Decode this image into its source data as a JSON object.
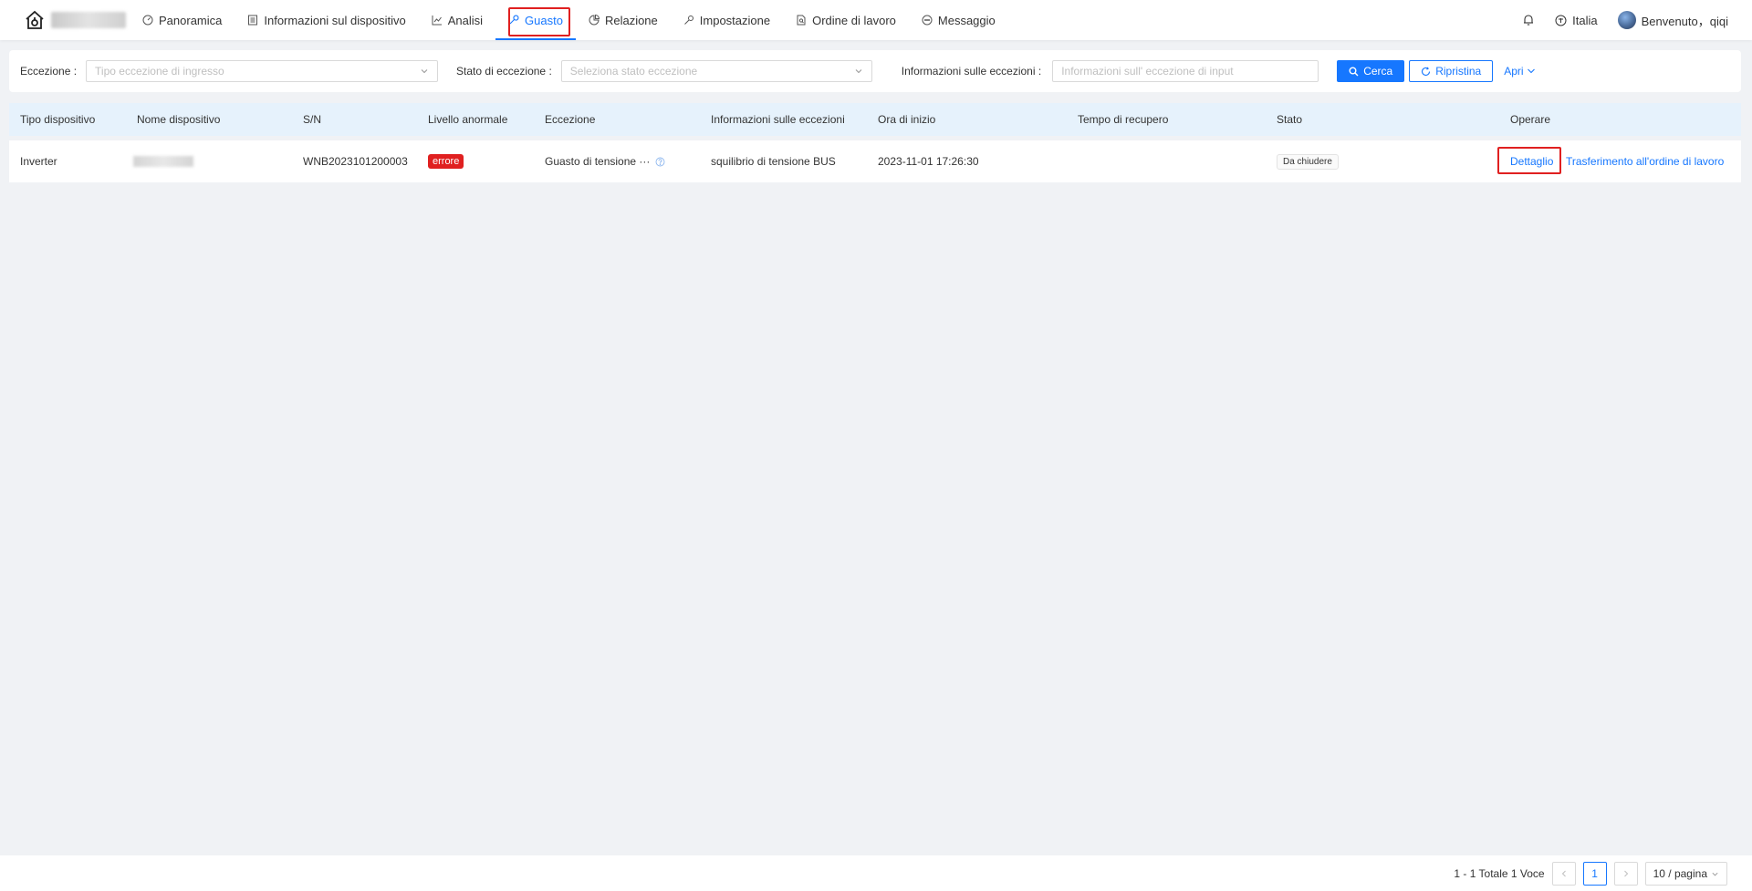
{
  "nav": {
    "items": [
      {
        "label": "Panoramica",
        "icon": "dashboard-icon"
      },
      {
        "label": "Informazioni sul dispositivo",
        "icon": "list-icon"
      },
      {
        "label": "Analisi",
        "icon": "line-chart-icon"
      },
      {
        "label": "Guasto",
        "icon": "wrench-icon",
        "active": true
      },
      {
        "label": "Relazione",
        "icon": "pie-chart-icon"
      },
      {
        "label": "Impostazione",
        "icon": "tool-icon"
      },
      {
        "label": "Ordine di lavoro",
        "icon": "file-search-icon"
      },
      {
        "label": "Messaggio",
        "icon": "message-icon"
      }
    ],
    "language": "Italia",
    "welcome": "Benvenuto，qiqi"
  },
  "filters": {
    "exception_label": "Eccezione :",
    "exception_placeholder": "Tipo eccezione di ingresso",
    "status_label": "Stato di eccezione :",
    "status_placeholder": "Seleziona stato eccezione",
    "info_label": "Informazioni sulle eccezioni :",
    "info_placeholder": "Informazioni sull' eccezione di input",
    "search_button": "Cerca",
    "reset_button": "Ripristina",
    "expand_link": "Apri"
  },
  "table": {
    "headers": [
      "Tipo dispositivo",
      "Nome dispositivo",
      "S/N",
      "Livello anormale",
      "Eccezione",
      "Informazioni sulle eccezioni",
      "Ora di inizio",
      "Tempo di recupero",
      "Stato",
      "Operare"
    ],
    "rows": [
      {
        "type": "Inverter",
        "sn": "WNB2023101200003",
        "level": "errore",
        "exception": "Guasto di tensione ···",
        "info": "squilibrio di tensione BUS",
        "start": "2023-11-01 17:26:30",
        "recovery": "",
        "status": "Da chiudere",
        "action_detail": "Dettaglio",
        "action_transfer": "Trasferimento all'ordine di lavoro"
      }
    ]
  },
  "pagination": {
    "summary": "1 - 1 Totale 1 Voce",
    "current": "1",
    "page_size": "10 / pagina"
  },
  "colors": {
    "primary": "#1677ff",
    "error": "#e02020",
    "header_bg": "#e6f2fc"
  }
}
